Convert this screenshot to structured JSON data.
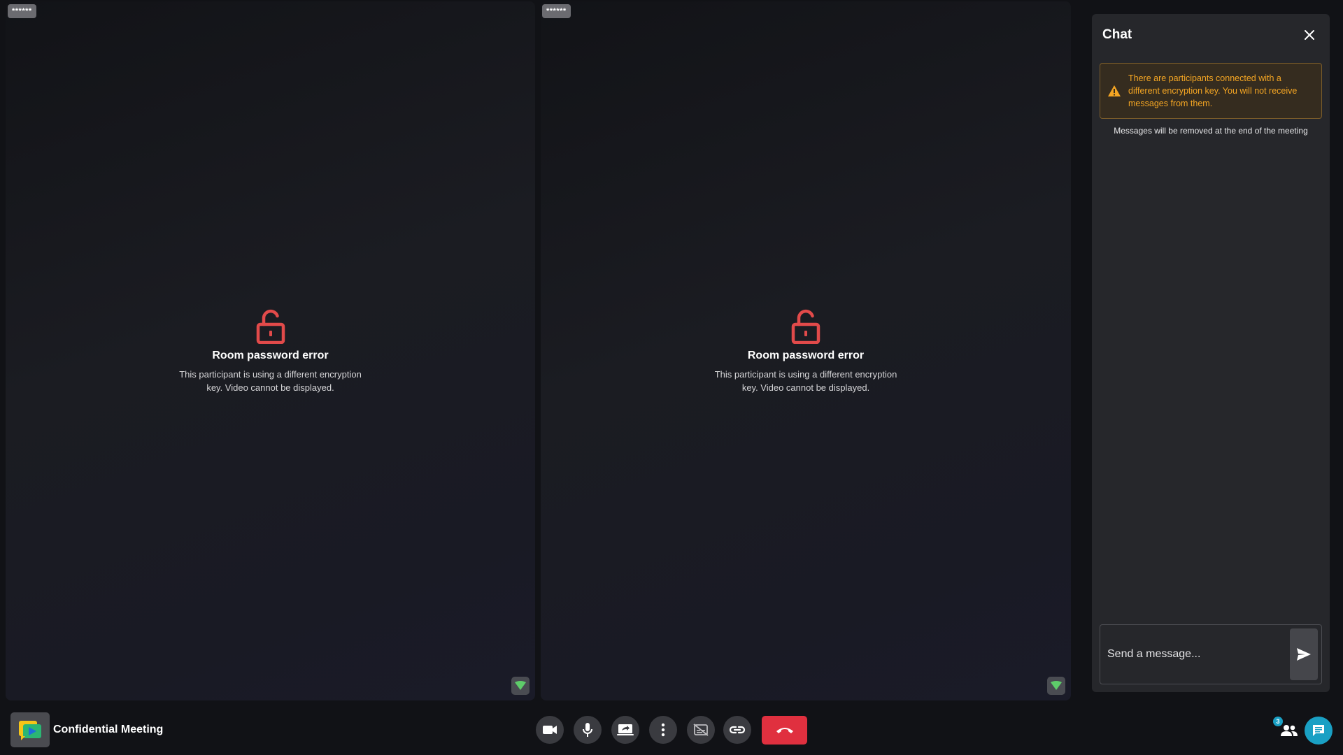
{
  "tiles": [
    {
      "name": "******",
      "error_title": "Room password error",
      "error_desc": "This participant is using a different encryption key. Video cannot be displayed."
    },
    {
      "name": "******",
      "error_title": "Room password error",
      "error_desc": "This participant is using a different encryption key. Video cannot be displayed."
    }
  ],
  "chat": {
    "title": "Chat",
    "warning": "There are participants connected with a different encryption key. You will not receive messages from them.",
    "note": "Messages will be removed at the end of the meeting",
    "input_placeholder": "Send a message..."
  },
  "toolbar": {
    "meeting_title": "Confidential Meeting",
    "participants_count": "3",
    "icons": {
      "camera": "video-camera-icon",
      "mic": "microphone-icon",
      "screen_share": "screen-share-icon",
      "more": "more-vertical-icon",
      "captions": "captions-off-icon",
      "link": "link-icon",
      "hangup": "hangup-icon",
      "participants": "participants-icon",
      "chat": "chat-icon"
    }
  },
  "colors": {
    "error_red": "#e24a4a",
    "warning_orange": "#f5a623",
    "hangup_red": "#e0303f",
    "accent_teal": "#1aa0c4",
    "connection_green": "#5ecc6a"
  }
}
